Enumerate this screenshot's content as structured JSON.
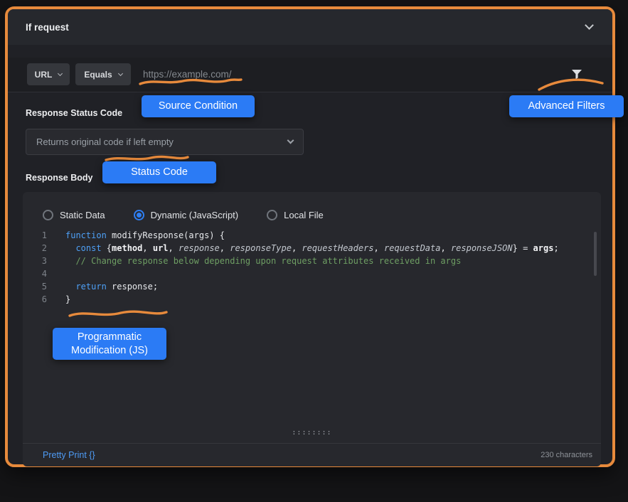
{
  "colors": {
    "frame_orange": "#E78A3C",
    "annotation_blue": "#2B7BF5",
    "keyword_blue": "#4EA0F6",
    "comment_green": "#6E9E63",
    "link_blue": "#4E9BF5"
  },
  "header": {
    "title": "If request"
  },
  "condition": {
    "key_label": "URL",
    "operator_label": "Equals",
    "url_placeholder": "https://example.com/"
  },
  "callouts": {
    "source_condition": "Source Condition",
    "advanced_filters": "Advanced Filters",
    "status_code": "Status Code",
    "programmatic_line1": "Programmatic",
    "programmatic_line2": "Modification (JS)"
  },
  "status_section": {
    "label": "Response Status Code",
    "dropdown_placeholder": "Returns original code if left empty"
  },
  "body_section": {
    "label": "Response Body",
    "options": [
      {
        "label": "Static Data",
        "selected": false
      },
      {
        "label": "Dynamic (JavaScript)",
        "selected": true
      },
      {
        "label": "Local File",
        "selected": false
      }
    ]
  },
  "editor": {
    "lines": [
      {
        "number": 1,
        "tokens": [
          {
            "t": "kw",
            "v": "function"
          },
          {
            "t": "plain",
            "v": " modifyResponse(args) {"
          }
        ]
      },
      {
        "number": 2,
        "tokens": [
          {
            "t": "plain",
            "v": "  "
          },
          {
            "t": "kw",
            "v": "const"
          },
          {
            "t": "plain",
            "v": " {"
          },
          {
            "t": "b",
            "v": "method"
          },
          {
            "t": "plain",
            "v": ", "
          },
          {
            "t": "b",
            "v": "url"
          },
          {
            "t": "plain",
            "v": ", "
          },
          {
            "t": "i",
            "v": "response"
          },
          {
            "t": "plain",
            "v": ", "
          },
          {
            "t": "i",
            "v": "responseType"
          },
          {
            "t": "plain",
            "v": ", "
          },
          {
            "t": "i",
            "v": "requestHeaders"
          },
          {
            "t": "plain",
            "v": ", "
          },
          {
            "t": "i",
            "v": "requestData"
          },
          {
            "t": "plain",
            "v": ", "
          },
          {
            "t": "i",
            "v": "responseJSON"
          },
          {
            "t": "plain",
            "v": "} = "
          },
          {
            "t": "b",
            "v": "args"
          },
          {
            "t": "plain",
            "v": ";"
          }
        ]
      },
      {
        "number": 3,
        "tokens": [
          {
            "t": "comment",
            "v": "  // Change response below depending upon request attributes received in args"
          }
        ]
      },
      {
        "number": 4,
        "tokens": []
      },
      {
        "number": 5,
        "tokens": [
          {
            "t": "plain",
            "v": "  "
          },
          {
            "t": "kw",
            "v": "return"
          },
          {
            "t": "plain",
            "v": " response;"
          }
        ]
      },
      {
        "number": 6,
        "tokens": [
          {
            "t": "plain",
            "v": "}"
          }
        ]
      }
    ],
    "resize_handle": "::::::::",
    "footer": {
      "pretty_print": "Pretty Print {}",
      "char_count": "230 characters"
    }
  }
}
